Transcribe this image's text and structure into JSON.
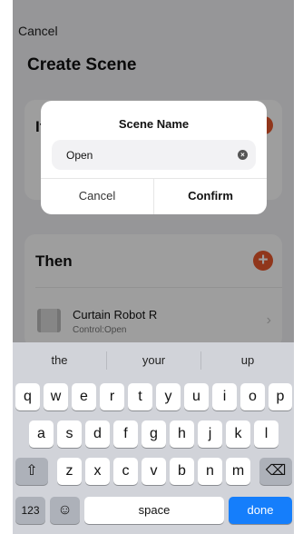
{
  "header": {
    "cancel_label": "Cancel",
    "title": "Create Scene"
  },
  "if_section": {
    "label": "If"
  },
  "then_section": {
    "label": "Then",
    "add_symbol": "+",
    "device": {
      "name": "Curtain Robot  R",
      "status": "Control:Open"
    }
  },
  "dialog": {
    "title": "Scene Name",
    "input_value": "Open",
    "cancel_label": "Cancel",
    "confirm_label": "Confirm"
  },
  "keyboard": {
    "suggestions": [
      "the",
      "your",
      "up"
    ],
    "row1": [
      "q",
      "w",
      "e",
      "r",
      "t",
      "y",
      "u",
      "i",
      "o",
      "p"
    ],
    "row2": [
      "a",
      "s",
      "d",
      "f",
      "g",
      "h",
      "j",
      "k",
      "l"
    ],
    "row3": [
      "z",
      "x",
      "c",
      "v",
      "b",
      "n",
      "m"
    ],
    "shift_glyph": "⇧",
    "backspace_glyph": "⌫",
    "numbers_label": "123",
    "emoji_glyph": "☺",
    "space_label": "space",
    "done_label": "done"
  },
  "colors": {
    "accent": "#e8572c",
    "done_blue": "#157efb"
  }
}
